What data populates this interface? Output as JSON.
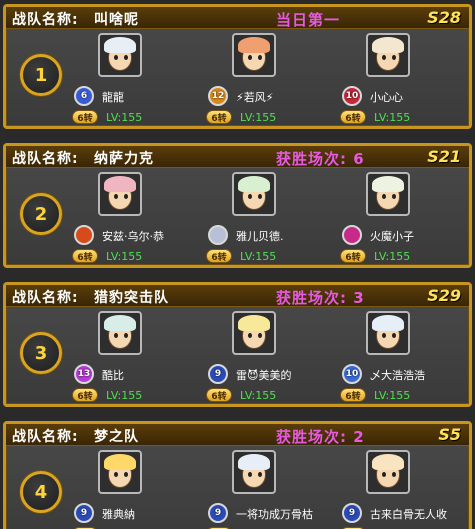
{
  "labels": {
    "team_name_label": "战队名称:"
  },
  "teams": [
    {
      "rank": "1",
      "name": "叫啥呢",
      "status": "当日第一",
      "server": "S28",
      "members": [
        {
          "name": "龍龍",
          "badge": "6",
          "badge_color": "#3a5bd8",
          "zhuan": "6转",
          "level": "LV:155",
          "hair": "#e8eef5"
        },
        {
          "name": "⚡若风⚡",
          "badge": "12",
          "badge_color": "#d88a1a",
          "zhuan": "6转",
          "level": "LV:155",
          "hair": "#f0a070"
        },
        {
          "name": "小心心",
          "badge": "10",
          "badge_color": "#c8263a",
          "zhuan": "6转",
          "level": "LV:155",
          "hair": "#f5e6d0"
        }
      ]
    },
    {
      "rank": "2",
      "name": "纳萨力克",
      "status": "获胜场次: 6",
      "server": "S21",
      "members": [
        {
          "name": "安兹·乌尔·恭",
          "badge": "",
          "badge_color": "#d84a1a",
          "zhuan": "6转",
          "level": "LV:155",
          "hair": "#f0b6c0"
        },
        {
          "name": "雅儿贝德.",
          "badge": "",
          "badge_color": "#b8c0d8",
          "zhuan": "6转",
          "level": "LV:155",
          "hair": "#d8f0d0"
        },
        {
          "name": "火魔小子",
          "badge": "",
          "badge_color": "#c82a8a",
          "zhuan": "6转",
          "level": "LV:155",
          "hair": "#eef2e0"
        }
      ]
    },
    {
      "rank": "3",
      "name": "猎豹突击队",
      "status": "获胜场次: 3",
      "server": "S29",
      "members": [
        {
          "name": "酷比",
          "badge": "13",
          "badge_color": "#b83ad8",
          "zhuan": "6转",
          "level": "LV:155",
          "hair": "#d8ece8"
        },
        {
          "name": "雷😈美美的",
          "badge": "9",
          "badge_color": "#2a4ab8",
          "zhuan": "6转",
          "level": "LV:155",
          "hair": "#f8e89a"
        },
        {
          "name": "乄大浩浩浩",
          "badge": "10",
          "badge_color": "#3a6ad8",
          "zhuan": "6转",
          "level": "LV:155",
          "hair": "#e6eef8"
        }
      ]
    },
    {
      "rank": "4",
      "name": "梦之队",
      "status": "获胜场次: 2",
      "server": "S5",
      "members": [
        {
          "name": "雅典納",
          "badge": "9",
          "badge_color": "#2a4ab8",
          "zhuan": "6转",
          "level": "LV:155",
          "hair": "#ffd86a"
        },
        {
          "name": "一将功成万骨枯",
          "badge": "9",
          "badge_color": "#2a4ab8",
          "zhuan": "6转",
          "level": "LV:155",
          "hair": "#e8eef8"
        },
        {
          "name": "古来白骨无人收",
          "badge": "9",
          "badge_color": "#2a4ab8",
          "zhuan": "6转",
          "level": "LV:155",
          "hair": "#f8e4c0"
        }
      ]
    }
  ]
}
